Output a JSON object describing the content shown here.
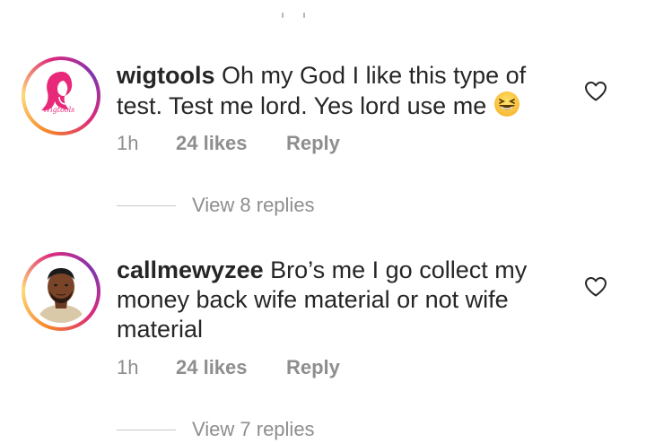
{
  "comments": [
    {
      "username": "wigtools",
      "text": "Oh my God I like this type of test. Test me lord. Yes lord use me",
      "emoji": "grinning-squinting-face",
      "avatar_text": "Wigtools",
      "time": "1h",
      "likes": "24 likes",
      "reply": "Reply",
      "view_replies": "View 8 replies",
      "like_icon": "heart-outline-icon"
    },
    {
      "username": "callmewyzee",
      "text": "Bro’s me I go collect my money back wife material or not wife material",
      "time": "1h",
      "likes": "24 likes",
      "reply": "Reply",
      "view_replies": "View 7 replies",
      "like_icon": "heart-outline-icon"
    }
  ],
  "colors": {
    "text": "#262626",
    "secondary": "#8e8e8e",
    "brand_pink": "#e8297a"
  }
}
